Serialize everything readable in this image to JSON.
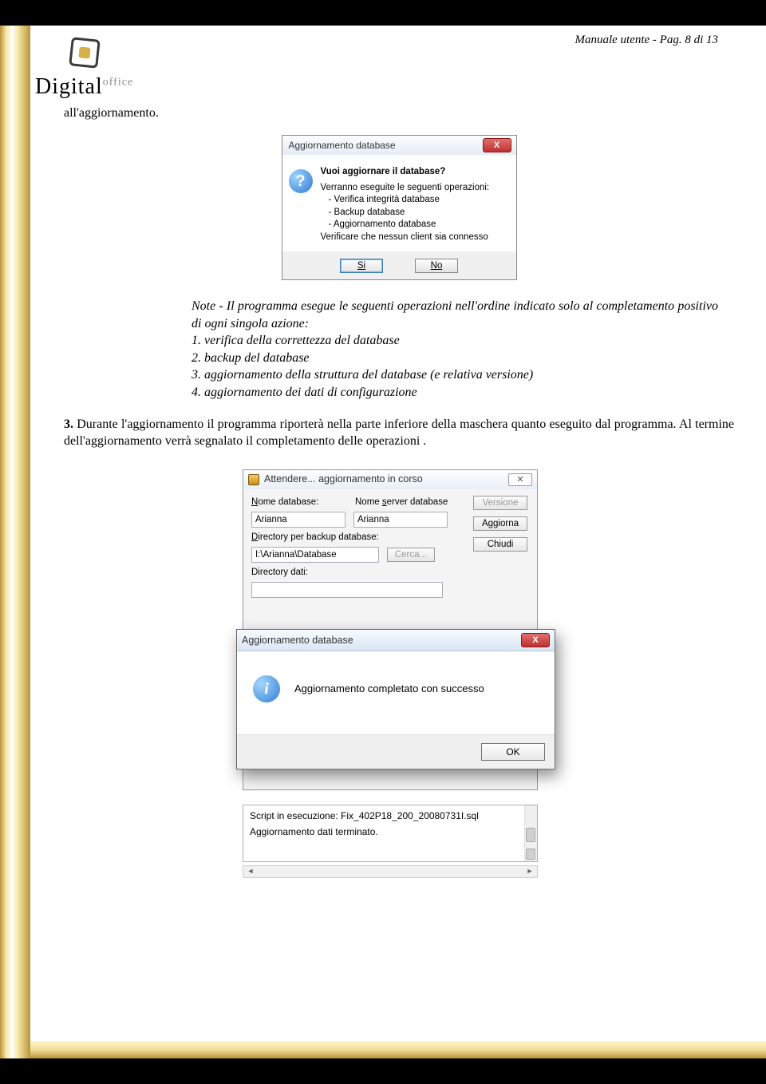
{
  "header": {
    "right": "Manuale utente - Pag. 8 di 13"
  },
  "logo": {
    "main": "Digital",
    "sub": "office"
  },
  "body": {
    "line1": "all'aggiornamento."
  },
  "dialog1": {
    "title": "Aggiornamento database",
    "question": "Vuoi aggiornare il database?",
    "lead": "Verranno eseguite le seguenti operazioni:",
    "op1": "- Verifica integrità database",
    "op2": "- Backup database",
    "op3": "- Aggiornamento database",
    "warn": "Verificare che nessun client sia connesso",
    "yes": "Si",
    "no": "No",
    "close": "X"
  },
  "note": {
    "intro": "Note - Il programma esegue le seguenti operazioni nell'ordine indicato solo al completamento positivo di ogni singola azione:",
    "n1": "1. verifica della correttezza del database",
    "n2": "2. backup del database",
    "n3": "3. aggiornamento della struttura del database (e relativa versione)",
    "n4": "4. aggiornamento dei dati di configurazione"
  },
  "section3": {
    "num": "3.",
    "text": " Durante l'aggiornamento il programma riporterà nella parte inferiore della maschera quanto eseguito dal programma. Al termine dell'aggiornamento verrà segnalato il completamento delle operazioni ."
  },
  "dialog2": {
    "title": "Attendere... aggiornamento in corso",
    "close": "✕",
    "lbl_dbname": "Nome database:",
    "lbl_dbserver": "Nome server database",
    "val_dbname": "Arianna",
    "val_dbserver": "Arianna",
    "lbl_backupdir": "Directory per backup database:",
    "val_backupdir": "I:\\Arianna\\Database",
    "btn_cerca": "Cerca...",
    "lbl_datadir": "Directory dati:",
    "btn_versione": "Versione",
    "btn_aggiorna": "Aggiorna",
    "btn_chiudi": "Chiudi",
    "log1": "Script in esecuzione: Fix_402P18_200_20080731I.sql",
    "log2": "Aggiornamento dati terminato."
  },
  "dialog_success": {
    "title": "Aggiornamento database",
    "msg": "Aggiornamento completato con successo",
    "ok": "OK",
    "close": "X"
  }
}
